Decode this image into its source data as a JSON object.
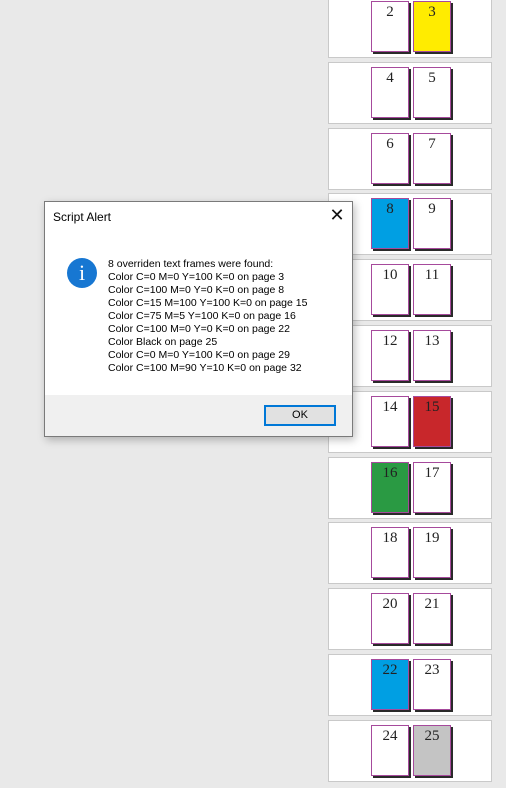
{
  "spreads": [
    {
      "left": {
        "num": "2",
        "fill": "#ffffff"
      },
      "right": {
        "num": "3",
        "fill": "#ffec00"
      }
    },
    {
      "left": {
        "num": "4",
        "fill": "#ffffff"
      },
      "right": {
        "num": "5",
        "fill": "#ffffff"
      }
    },
    {
      "left": {
        "num": "6",
        "fill": "#ffffff"
      },
      "right": {
        "num": "7",
        "fill": "#ffffff"
      }
    },
    {
      "left": {
        "num": "8",
        "fill": "#009fe3"
      },
      "right": {
        "num": "9",
        "fill": "#ffffff"
      }
    },
    {
      "left": {
        "num": "10",
        "fill": "#ffffff"
      },
      "right": {
        "num": "11",
        "fill": "#ffffff"
      }
    },
    {
      "left": {
        "num": "12",
        "fill": "#ffffff"
      },
      "right": {
        "num": "13",
        "fill": "#ffffff"
      }
    },
    {
      "left": {
        "num": "14",
        "fill": "#ffffff"
      },
      "right": {
        "num": "15",
        "fill": "#c8272b"
      }
    },
    {
      "left": {
        "num": "16",
        "fill": "#2a9a43"
      },
      "right": {
        "num": "17",
        "fill": "#ffffff"
      }
    },
    {
      "left": {
        "num": "18",
        "fill": "#ffffff"
      },
      "right": {
        "num": "19",
        "fill": "#ffffff"
      }
    },
    {
      "left": {
        "num": "20",
        "fill": "#ffffff"
      },
      "right": {
        "num": "21",
        "fill": "#ffffff"
      }
    },
    {
      "left": {
        "num": "22",
        "fill": "#009fe3"
      },
      "right": {
        "num": "23",
        "fill": "#ffffff"
      }
    },
    {
      "left": {
        "num": "24",
        "fill": "#ffffff"
      },
      "right": {
        "num": "25",
        "fill": "#c4c4c4"
      }
    }
  ],
  "dialog": {
    "title": "Script Alert",
    "close_icon": "close-icon",
    "info_icon": "info-icon",
    "message_lines": [
      "8 overriden text frames were found:",
      "Color C=0 M=0 Y=100 K=0 on page 3",
      "Color C=100 M=0 Y=0 K=0 on page 8",
      "Color C=15 M=100 Y=100 K=0 on page 15",
      "Color C=75 M=5 Y=100 K=0 on page 16",
      "Color C=100 M=0 Y=0 K=0 on page 22",
      "Color Black on page 25",
      "Color C=0 M=0 Y=100 K=0 on page 29",
      "Color C=100 M=90 Y=10 K=0 on page 32"
    ],
    "ok_label": "OK"
  }
}
